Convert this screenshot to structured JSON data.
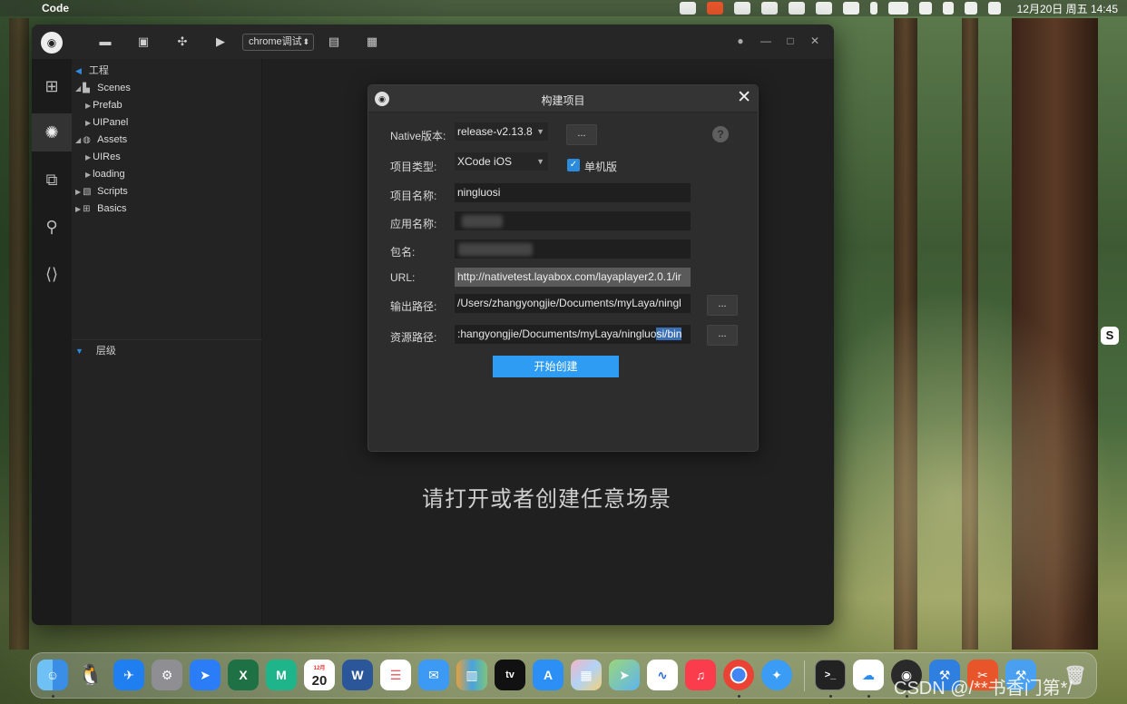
{
  "menubar": {
    "app_name": "Code",
    "clock": "12月20日 周五 14:45"
  },
  "toolbar": {
    "run_target": "chrome调试"
  },
  "tree": {
    "header": "工程",
    "nodes": [
      {
        "label": "Scenes",
        "level": 0
      },
      {
        "label": "Prefab",
        "level": 1
      },
      {
        "label": "UIPanel",
        "level": 1
      },
      {
        "label": "Assets",
        "level": 0
      },
      {
        "label": "UIRes",
        "level": 1
      },
      {
        "label": "loading",
        "level": 1
      },
      {
        "label": "Scripts",
        "level": 0
      },
      {
        "label": "Basics",
        "level": 0
      }
    ],
    "hierarchy_header": "层级"
  },
  "stage": {
    "message": "请打开或者创建任意场景"
  },
  "dialog": {
    "title": "构建项目",
    "close": "✕",
    "native_label": "Native版本:",
    "native_value": "release-v2.13.8",
    "type_label": "项目类型:",
    "type_value": "XCode iOS",
    "standalone_label": "单机版",
    "standalone_checked": true,
    "project_name_label": "项目名称:",
    "project_name_value": "ningluosi",
    "app_name_label": "应用名称:",
    "package_label": "包名:",
    "url_label": "URL:",
    "url_value": "http://nativetest.layabox.com/layaplayer2.0.1/ir",
    "output_label": "输出路径:",
    "output_value": "/Users/zhangyongjie/Documents/myLaya/ningl",
    "resource_label": "资源路径:",
    "resource_value_a": ":hangyongjie/Documents/myLaya/ningluo",
    "resource_value_b": "si/bin",
    "browse": "...",
    "help": "?",
    "create_button": "开始创建"
  },
  "desktop": {
    "watermark": "CSDN @/**书香门第*/"
  },
  "dock": {
    "items": [
      "finder-icon",
      "qq-icon",
      "feishu-icon",
      "system-preferences-icon",
      "lark-icon",
      "excel-icon",
      "mindnode-icon",
      "calendar-icon",
      "word-icon",
      "reminders-icon",
      "mail-icon",
      "books-icon",
      "apple-tv-icon",
      "app-store-icon",
      "launchpad-icon",
      "maps-icon",
      "freeform-icon",
      "music-icon",
      "chrome-icon",
      "safari-icon",
      "terminal-icon",
      "edge-like-icon",
      "layaair-icon",
      "cutter-icon",
      "xcode-icon",
      "xcode-icon",
      "trash-icon"
    ],
    "calendar_day": "20",
    "calendar_month": "12月",
    "appletv_label": "tv"
  }
}
